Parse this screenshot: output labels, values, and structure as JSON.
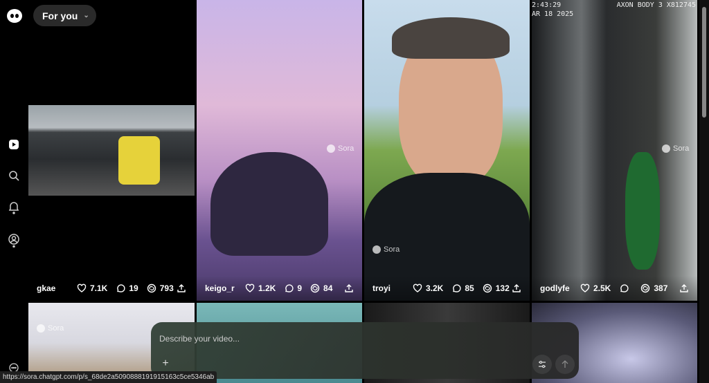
{
  "header": {
    "filter_label": "For you",
    "logo_icon": "sora-logo-icon"
  },
  "sidebar": {
    "items": [
      {
        "name": "explore",
        "icon": "play-icon"
      },
      {
        "name": "search",
        "icon": "search-icon"
      },
      {
        "name": "notifications",
        "icon": "bell-icon"
      },
      {
        "name": "profile",
        "icon": "profile-icon"
      },
      {
        "name": "more",
        "icon": "more-icon"
      }
    ]
  },
  "feed": {
    "watermark": "Sora",
    "row1": [
      {
        "user": "gkae",
        "likes": "7.1K",
        "comments": "19",
        "remixes": "793"
      },
      {
        "user": "keigo_r",
        "likes": "1.2K",
        "comments": "9",
        "remixes": "84"
      },
      {
        "user": "troyi",
        "likes": "3.2K",
        "comments": "85",
        "remixes": "132"
      },
      {
        "user": "godlyfe",
        "likes": "2.5K",
        "comments": "",
        "remixes": "387",
        "overlay_time": "2:43:29",
        "overlay_date": "AR 18 2025",
        "overlay_device": "AXON BODY 3 X812745"
      }
    ]
  },
  "prompt": {
    "placeholder": "Describe your video...",
    "add_label": "+",
    "settings_icon": "sliders-icon",
    "submit_icon": "arrow-up-icon"
  },
  "status_url": "https://sora.chatgpt.com/p/s_68de2a5090888191915163c5ce5346ab"
}
